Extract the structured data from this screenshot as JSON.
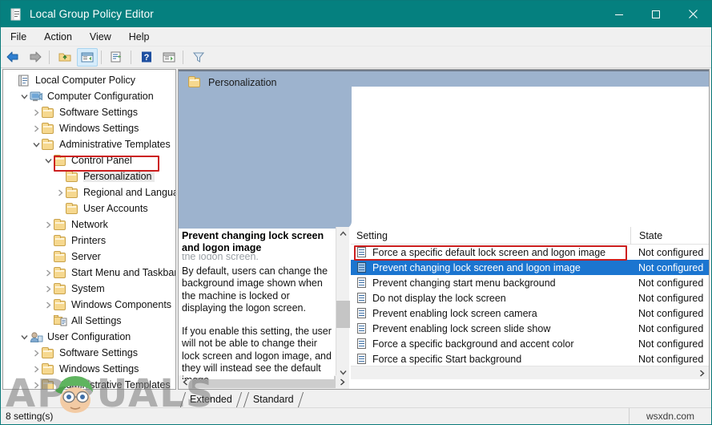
{
  "window": {
    "title": "Local Group Policy Editor",
    "icon": "policy-scroll-icon",
    "titlebar_color": "#05807f",
    "controls": {
      "minimize": "—",
      "maximize": "□",
      "close": "✕"
    }
  },
  "menubar": {
    "items": [
      "File",
      "Action",
      "View",
      "Help"
    ]
  },
  "toolbar": {
    "buttons": [
      {
        "name": "back-icon",
        "glyph": "back"
      },
      {
        "name": "forward-icon",
        "glyph": "forward"
      },
      {
        "name": "up-folder-icon",
        "glyph": "upfolder"
      },
      {
        "name": "show-hide-console-tree-icon",
        "glyph": "console-tree",
        "active": true
      },
      {
        "name": "export-list-icon",
        "glyph": "export"
      },
      {
        "name": "help-icon",
        "glyph": "help"
      },
      {
        "name": "show-hide-action-pane-icon",
        "glyph": "action-pane"
      },
      {
        "name": "filter-icon",
        "glyph": "filter"
      }
    ]
  },
  "tree": {
    "nodes": [
      {
        "label": "Local Computer Policy",
        "indent": 0,
        "chevron": "none",
        "icon": "policy-scroll-icon"
      },
      {
        "label": "Computer Configuration",
        "indent": 1,
        "chevron": "down",
        "icon": "computer-icon"
      },
      {
        "label": "Software Settings",
        "indent": 2,
        "chevron": "right",
        "icon": "folder-icon"
      },
      {
        "label": "Windows Settings",
        "indent": 2,
        "chevron": "right",
        "icon": "folder-icon"
      },
      {
        "label": "Administrative Templates",
        "indent": 2,
        "chevron": "down",
        "icon": "folder-icon"
      },
      {
        "label": "Control Panel",
        "indent": 3,
        "chevron": "down",
        "icon": "folder-icon"
      },
      {
        "label": "Personalization",
        "indent": 4,
        "chevron": "none",
        "icon": "folder-icon",
        "selected": true,
        "highlight_box": true
      },
      {
        "label": "Regional and Languag",
        "indent": 4,
        "chevron": "right",
        "icon": "folder-icon"
      },
      {
        "label": "User Accounts",
        "indent": 4,
        "chevron": "none",
        "icon": "folder-icon"
      },
      {
        "label": "Network",
        "indent": 3,
        "chevron": "right",
        "icon": "folder-icon"
      },
      {
        "label": "Printers",
        "indent": 3,
        "chevron": "none",
        "icon": "folder-icon"
      },
      {
        "label": "Server",
        "indent": 3,
        "chevron": "none",
        "icon": "folder-icon"
      },
      {
        "label": "Start Menu and Taskbar",
        "indent": 3,
        "chevron": "right",
        "icon": "folder-icon"
      },
      {
        "label": "System",
        "indent": 3,
        "chevron": "right",
        "icon": "folder-icon"
      },
      {
        "label": "Windows Components",
        "indent": 3,
        "chevron": "right",
        "icon": "folder-icon"
      },
      {
        "label": "All Settings",
        "indent": 3,
        "chevron": "none",
        "icon": "all-settings-icon"
      },
      {
        "label": "User Configuration",
        "indent": 1,
        "chevron": "down",
        "icon": "user-icon"
      },
      {
        "label": "Software Settings",
        "indent": 2,
        "chevron": "right",
        "icon": "folder-icon"
      },
      {
        "label": "Windows Settings",
        "indent": 2,
        "chevron": "right",
        "icon": "folder-icon"
      },
      {
        "label": "Administrative Templates",
        "indent": 2,
        "chevron": "right",
        "icon": "folder-icon"
      }
    ]
  },
  "banner": {
    "title": "Personalization",
    "icon": "folder-icon",
    "color": "#9db3ce"
  },
  "description": {
    "title": "Prevent changing lock screen and logon image",
    "ghost_line": "the logon screen.",
    "paragraphs": [
      "By default, users can change the background image shown when the machine is locked or displaying the logon screen.",
      "If you enable this setting, the user will not be able to change their lock screen and logon image, and they will instead see the default image."
    ]
  },
  "settings_list": {
    "columns": [
      "Setting",
      "State"
    ],
    "rows": [
      {
        "setting": "Force a specific default lock screen and logon image",
        "state": "Not configured",
        "selected": false
      },
      {
        "setting": "Prevent changing lock screen and logon image",
        "state": "Not configured",
        "selected": true,
        "highlight_box": true
      },
      {
        "setting": "Prevent changing start menu background",
        "state": "Not configured",
        "selected": false
      },
      {
        "setting": "Do not display the lock screen",
        "state": "Not configured",
        "selected": false
      },
      {
        "setting": "Prevent enabling lock screen camera",
        "state": "Not configured",
        "selected": false
      },
      {
        "setting": "Prevent enabling lock screen slide show",
        "state": "Not configured",
        "selected": false
      },
      {
        "setting": "Force a specific background and accent color",
        "state": "Not configured",
        "selected": false
      },
      {
        "setting": "Force a specific Start background",
        "state": "Not configured",
        "selected": false
      }
    ]
  },
  "tabs": [
    {
      "label": "Extended",
      "active": true
    },
    {
      "label": "Standard",
      "active": false
    }
  ],
  "statusbar": {
    "text": "8 setting(s)",
    "right_text": ""
  },
  "watermarks": {
    "appuals": "APPUALS",
    "wsxdn": "wsxdn.com"
  },
  "colors": {
    "accent": "#05807f",
    "selection": "#1b75d0",
    "highlight_box": "#cc1f1f",
    "banner": "#9db3ce"
  }
}
